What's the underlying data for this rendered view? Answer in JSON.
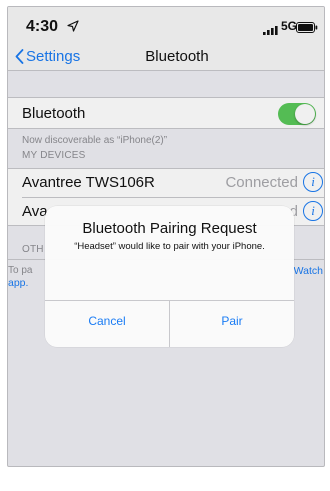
{
  "status_bar": {
    "time": "4:30",
    "network": "5G",
    "icons": [
      "location-arrow-icon",
      "signal-bars-icon",
      "battery-icon"
    ]
  },
  "nav": {
    "back_label": "Settings",
    "title": "Bluetooth"
  },
  "bluetooth": {
    "label": "Bluetooth",
    "enabled": true,
    "discoverable_text": "Now discoverable as “iPhone(2)”"
  },
  "my_devices": {
    "header": "MY DEVICES",
    "items": [
      {
        "name": "Avantree TWS106R",
        "status": "Connected"
      },
      {
        "name": "Ava",
        "status": "d"
      }
    ]
  },
  "other_devices": {
    "header_fragment": "OTH",
    "note_fragment_left": "To pa",
    "note_fragment_right": "Watch",
    "note_line2": "app."
  },
  "alert": {
    "title": "Bluetooth Pairing Request",
    "message": "“Headset” would like to pair with your iPhone.",
    "cancel_label": "Cancel",
    "pair_label": "Pair"
  },
  "colors": {
    "accent": "#1a7cf4",
    "toggle_on": "#5ac85a",
    "group_background": "#efeff4",
    "secondary_text": "#8e8e93"
  }
}
